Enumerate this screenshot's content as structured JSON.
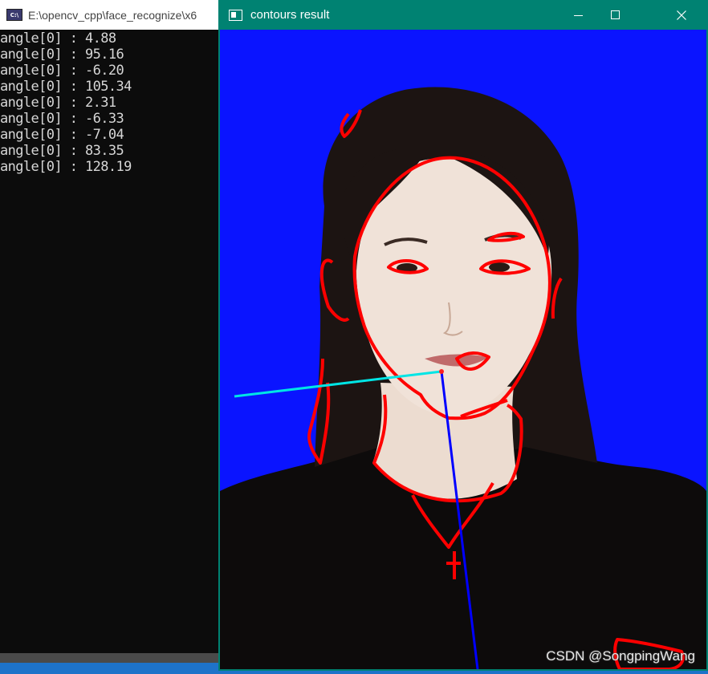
{
  "console": {
    "title": "E:\\opencv_cpp\\face_recognize\\x6",
    "icon": "console-app-icon",
    "lines": [
      "angle[0] : 4.88",
      "angle[0] : 95.16",
      "angle[0] : -6.20",
      "angle[0] : 105.34",
      "angle[0] : 2.31",
      "angle[0] : -6.33",
      "angle[0] : -7.04",
      "angle[0] : 83.35",
      "angle[0] : 128.19"
    ]
  },
  "image_window": {
    "title": "contours result",
    "controls": [
      "minimize",
      "maximize",
      "close"
    ],
    "titlebar_color": "#008272",
    "background_color": "#0a14ff",
    "contour_color": "#ff0000",
    "axis_colors": {
      "horizontal": "#00e5e5",
      "vertical": "#0000ff"
    }
  },
  "watermark": "CSDN @SongpingWang"
}
